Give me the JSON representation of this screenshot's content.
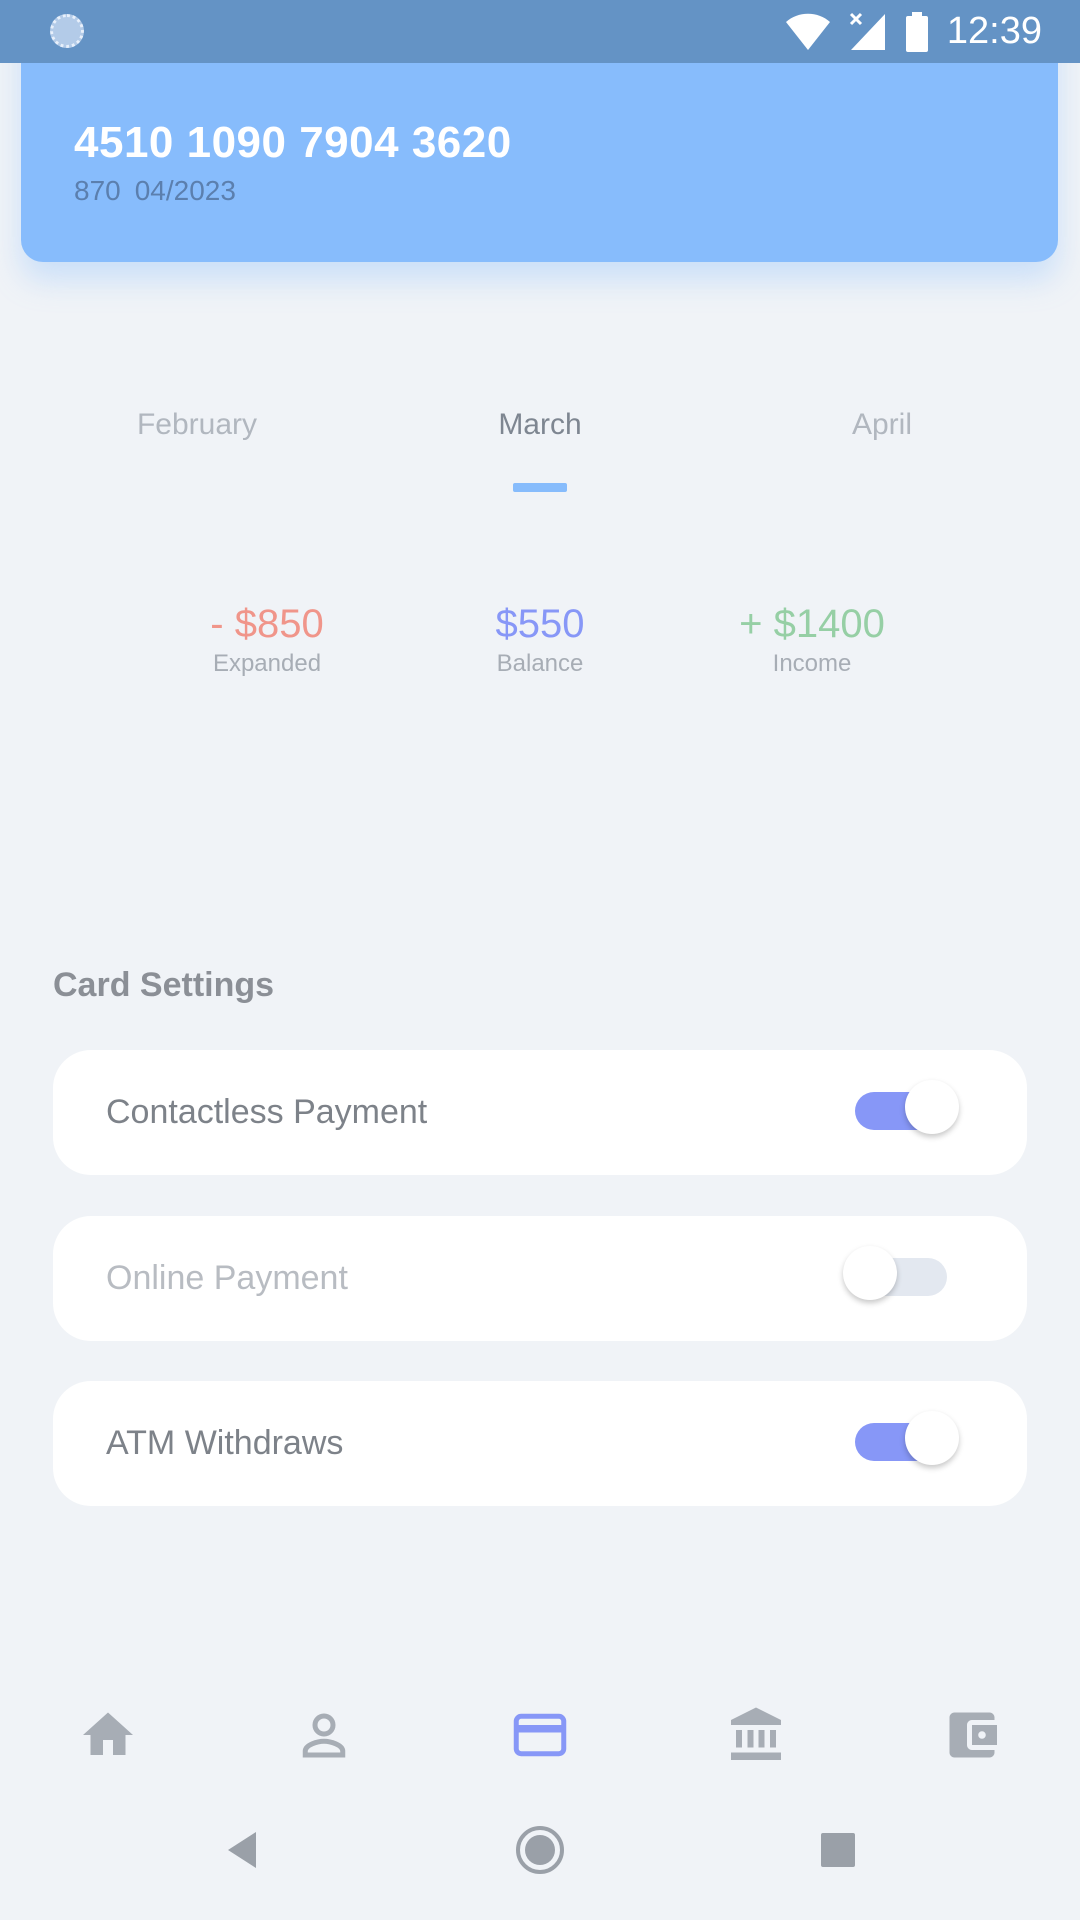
{
  "status_bar": {
    "time": "12:39",
    "icons": [
      "loading-icon",
      "wifi-icon",
      "signal-icon",
      "battery-icon"
    ]
  },
  "card": {
    "number": "4510 1090 7904 3620",
    "cvv": "870",
    "expiry": "04/2023",
    "color": "#87bcfc"
  },
  "months": {
    "items": [
      "February",
      "March",
      "April"
    ],
    "selected": "March"
  },
  "stats": {
    "expanded": {
      "amount": "- $850",
      "label": "Expanded",
      "color": "#f0958a"
    },
    "balance": {
      "amount": "$550",
      "label": "Balance",
      "color": "#8797f7"
    },
    "income": {
      "amount": "+ $1400",
      "label": "Income",
      "color": "#96cfa5"
    }
  },
  "settings": {
    "title": "Card Settings",
    "items": [
      {
        "label": "Contactless Payment",
        "enabled": true
      },
      {
        "label": "Online Payment",
        "enabled": false
      },
      {
        "label": "ATM Withdraws",
        "enabled": true
      }
    ]
  },
  "bottom_nav": {
    "items": [
      "home-icon",
      "profile-icon",
      "card-icon",
      "bank-icon",
      "wallet-icon"
    ],
    "active": "card-icon"
  },
  "system_nav": {
    "items": [
      "back-icon",
      "home-circle-icon",
      "recents-icon"
    ]
  }
}
